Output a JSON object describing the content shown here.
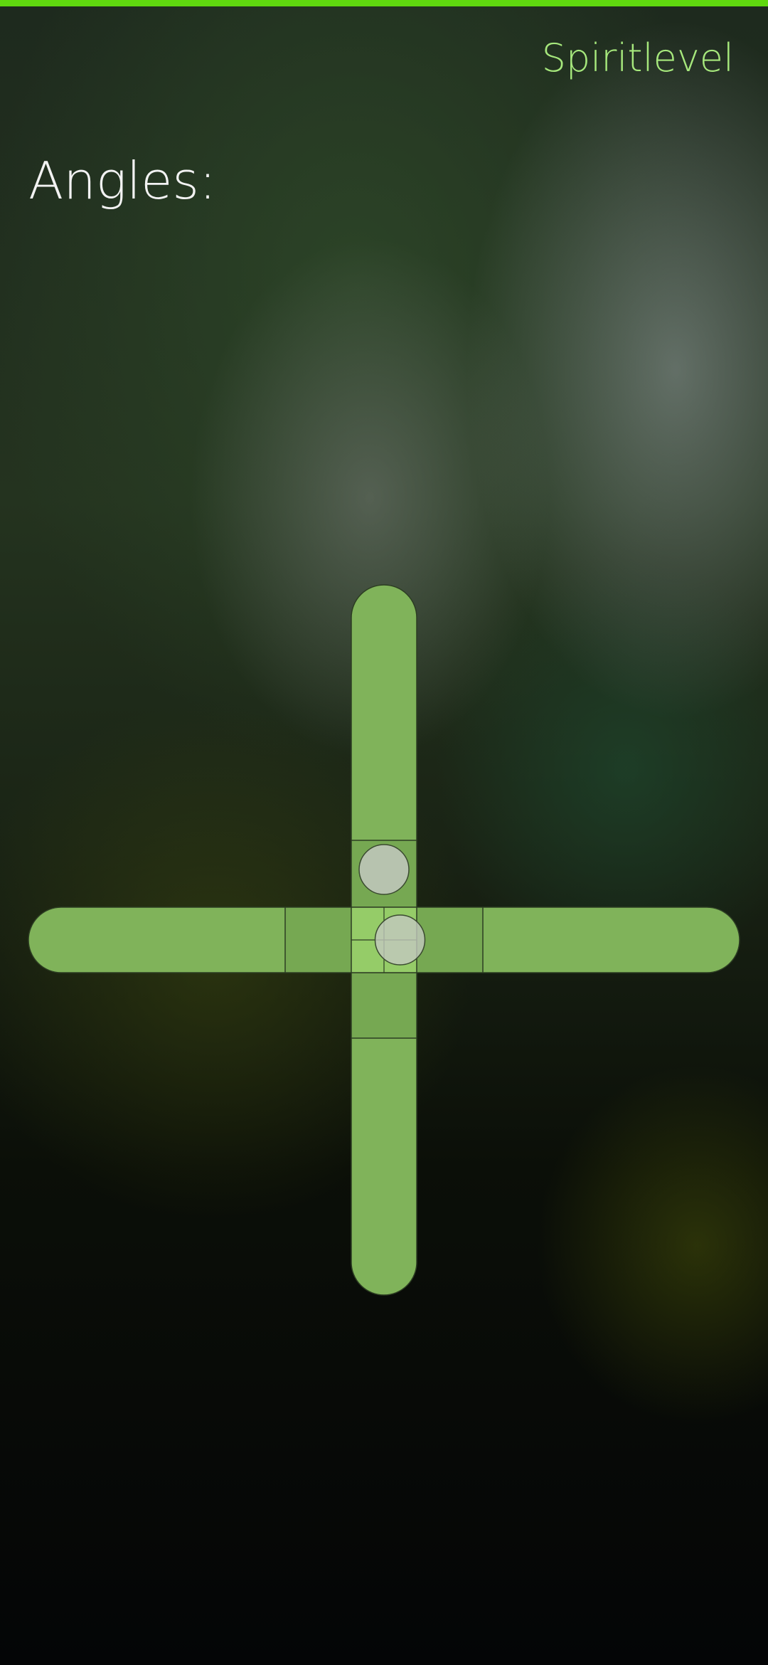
{
  "header": {
    "app_title": "Spiritlevel",
    "accent_color": "#5fd80f"
  },
  "main": {
    "angles_label": "Angles:"
  },
  "level": {
    "tube_color": "#80b35a",
    "center_color": "#95cc68",
    "bubble_color": "#c3c8bf",
    "vertical_bubble_offset": -0.22,
    "horizontal_bubble_offset": 0.05
  }
}
